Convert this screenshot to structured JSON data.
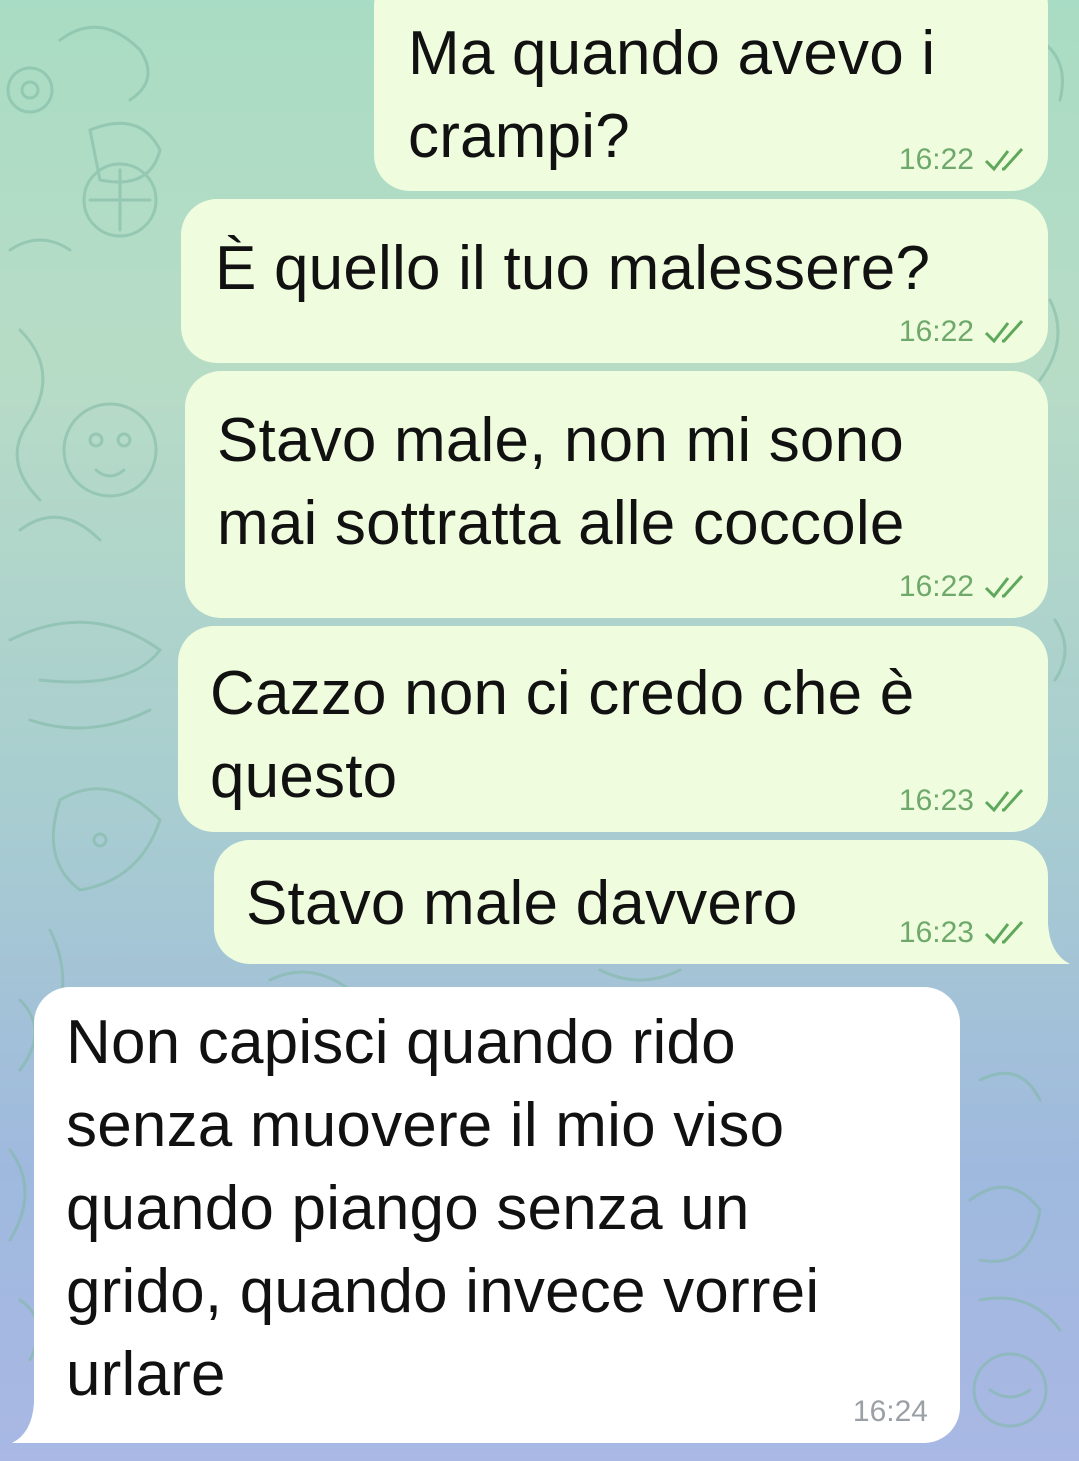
{
  "chat": {
    "messages": [
      {
        "direction": "outgoing",
        "text": "Ma quando avevo i\ncrampi?",
        "time": "16:22",
        "status": "read-double-check-icon"
      },
      {
        "direction": "outgoing",
        "text": "È quello il tuo malessere?",
        "time": "16:22",
        "status": "read-double-check-icon"
      },
      {
        "direction": "outgoing",
        "text": "Stavo male, non mi sono\nmai sottratta alle coccole",
        "time": "16:22",
        "status": "read-double-check-icon"
      },
      {
        "direction": "outgoing",
        "text": "Cazzo non ci credo che è\nquesto",
        "time": "16:23",
        "status": "read-double-check-icon"
      },
      {
        "direction": "outgoing",
        "text": "Stavo male davvero",
        "time": "16:23",
        "status": "read-double-check-icon"
      },
      {
        "direction": "incoming",
        "text": "Non capisci quando rido\nsenza muovere il mio viso\nquando piango senza un\ngrido, quando invece vorrei\nurlare",
        "time": "16:24"
      }
    ]
  },
  "colors": {
    "outgoing_bubble": "#effdde",
    "incoming_bubble": "#ffffff",
    "read_checks": "#5fa85b",
    "wallpaper_top": "#a9dcc4",
    "wallpaper_bottom": "#a9b8e4"
  }
}
